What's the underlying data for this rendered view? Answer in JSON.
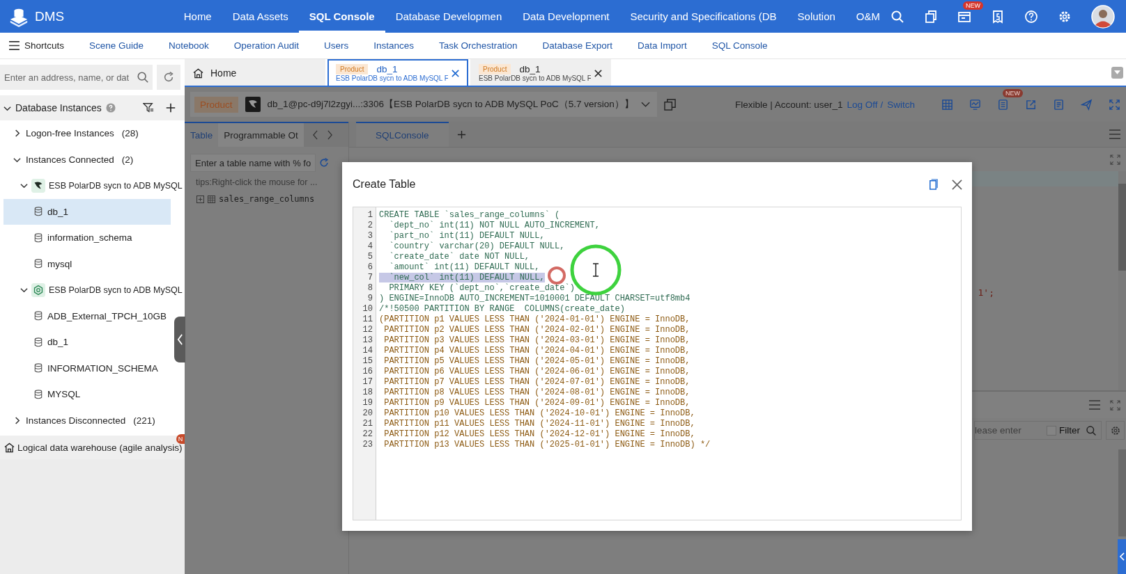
{
  "header": {
    "logo": "DMS",
    "nav": [
      {
        "label": "Home",
        "selected": false
      },
      {
        "label": "Data Assets",
        "selected": false
      },
      {
        "label": "SQL Console",
        "selected": true
      },
      {
        "label": "Database Developmen",
        "selected": false
      },
      {
        "label": "Data Development",
        "selected": false
      },
      {
        "label": "Security and Specifications (DB",
        "selected": false
      },
      {
        "label": "Solution",
        "selected": false
      },
      {
        "label": "O&M",
        "selected": false
      }
    ],
    "icons": [
      {
        "kind": "search"
      },
      {
        "kind": "copy"
      },
      {
        "kind": "ticket",
        "badge": "NEW"
      },
      {
        "kind": "receipt"
      },
      {
        "kind": "help"
      },
      {
        "kind": "settings"
      },
      {
        "kind": "avatar"
      }
    ]
  },
  "shortcuts": {
    "label": "Shortcuts",
    "links": [
      "Scene Guide",
      "Notebook",
      "Operation Audit",
      "Users",
      "Instances",
      "Task Orchestration",
      "Database Export",
      "Data Import",
      "SQL Console"
    ]
  },
  "sidebar": {
    "search": {
      "placeholder": "Enter an address, name, or dat"
    },
    "section": {
      "title": "Database Instances",
      "expanded": true
    },
    "tree": [
      {
        "kind": "group",
        "label": "Logon-free Instances",
        "count": "(28)",
        "expanded": false
      },
      {
        "kind": "group",
        "label": "Instances Connected",
        "count": "(2)",
        "expanded": true,
        "children": [
          {
            "kind": "polardb",
            "label": "ESB PolarDB sycn to ADB MySQL",
            "expanded": true,
            "children": [
              {
                "kind": "database",
                "label": "db_1",
                "selected": true
              },
              {
                "kind": "database",
                "label": "information_schema",
                "selected": false
              },
              {
                "kind": "database",
                "label": "mysql",
                "selected": false
              }
            ]
          },
          {
            "kind": "adb",
            "label": "ESB PolarDB sycn to ADB MySQL",
            "expanded": true,
            "children": [
              {
                "kind": "database",
                "label": "ADB_External_TPCH_10GB",
                "selected": false
              },
              {
                "kind": "database",
                "label": "db_1",
                "selected": false
              },
              {
                "kind": "database",
                "label": "INFORMATION_SCHEMA",
                "selected": false
              },
              {
                "kind": "database",
                "label": "MYSQL",
                "selected": false
              }
            ]
          }
        ]
      },
      {
        "kind": "group",
        "label": "Instances Disconnected",
        "count": "(221)",
        "expanded": false
      }
    ],
    "footer": {
      "label": "Logical data warehouse (agile analysis)",
      "badge": "N"
    }
  },
  "tabs": [
    {
      "kind": "home",
      "label": "Home",
      "selected": false
    },
    {
      "kind": "db",
      "tag": "Product",
      "label": "db_1",
      "subtitle": "ESB PolarDB sycn to ADB MySQL F",
      "selected": true
    },
    {
      "kind": "db",
      "tag": "Product",
      "label": "db_1",
      "subtitle": "ESB PolarDB sycn to ADB MySQL F",
      "selected": false
    }
  ],
  "connection": {
    "tag": "Product",
    "label": "db_1@pc-d9j7l2zgyi...:3306【ESB PolarDB sycn to ADB MySQL PoC（5.7 version）】",
    "account": "Flexible | Account: user_1",
    "log_off": "Log Off",
    "separator": "/",
    "switch": "Switch",
    "toolbar": [
      {
        "kind": "grid"
      },
      {
        "kind": "monitor"
      },
      {
        "kind": "list",
        "badge": "NEW"
      },
      {
        "kind": "export"
      },
      {
        "kind": "doc"
      },
      {
        "kind": "send"
      },
      {
        "kind": "fullscreen"
      }
    ]
  },
  "object_panel": {
    "tabs": [
      {
        "label": "Table",
        "selected": true
      },
      {
        "label": "Programmable Ot",
        "selected": false
      }
    ],
    "search": {
      "placeholder": "Enter a table name with % fo"
    },
    "tip": "tips:Right-click the mouse for ...",
    "tables": [
      {
        "name": "sales_range_columns",
        "expanded": false
      }
    ]
  },
  "console": {
    "tabs": [
      {
        "label": "SQLConsole",
        "selected": true
      }
    ],
    "code_fragment": "1';",
    "results": {
      "search": {
        "placeholder": "lease enter"
      },
      "filter": {
        "label": "Filter",
        "checked": false
      }
    }
  },
  "dialog": {
    "title": "Create Table",
    "lines": [
      {
        "n": "1",
        "kind": "ddl",
        "selected": false,
        "text": "CREATE TABLE `sales_range_columns` ("
      },
      {
        "n": "2",
        "kind": "ddl",
        "selected": false,
        "text": "  `dept_no` int(11) NOT NULL AUTO_INCREMENT,"
      },
      {
        "n": "3",
        "kind": "ddl",
        "selected": false,
        "text": "  `part_no` int(11) DEFAULT NULL,"
      },
      {
        "n": "4",
        "kind": "ddl",
        "selected": false,
        "text": "  `country` varchar(20) DEFAULT NULL,"
      },
      {
        "n": "5",
        "kind": "ddl",
        "selected": false,
        "text": "  `create_date` date NOT NULL,"
      },
      {
        "n": "6",
        "kind": "ddl",
        "selected": false,
        "text": "  `amount` int(11) DEFAULT NULL,"
      },
      {
        "n": "7",
        "kind": "ddl",
        "selected": true,
        "text": "  `new_col` int(11) DEFAULT NULL,"
      },
      {
        "n": "8",
        "kind": "ddl",
        "selected": false,
        "text": "  PRIMARY KEY (`dept_no`,`create_date`)"
      },
      {
        "n": "9",
        "kind": "ddl",
        "selected": false,
        "text": ") ENGINE=InnoDB AUTO_INCREMENT=1010001 DEFAULT CHARSET=utf8mb4"
      },
      {
        "n": "10",
        "kind": "ddl",
        "selected": false,
        "text": "/*!50500 PARTITION BY RANGE  COLUMNS(create_date)"
      },
      {
        "n": "11",
        "kind": "partition",
        "selected": false,
        "text": "(PARTITION p1 VALUES LESS THAN ('2024-01-01') ENGINE = InnoDB,"
      },
      {
        "n": "12",
        "kind": "partition",
        "selected": false,
        "text": " PARTITION p2 VALUES LESS THAN ('2024-02-01') ENGINE = InnoDB,"
      },
      {
        "n": "13",
        "kind": "partition",
        "selected": false,
        "text": " PARTITION p3 VALUES LESS THAN ('2024-03-01') ENGINE = InnoDB,"
      },
      {
        "n": "14",
        "kind": "partition",
        "selected": false,
        "text": " PARTITION p4 VALUES LESS THAN ('2024-04-01') ENGINE = InnoDB,"
      },
      {
        "n": "15",
        "kind": "partition",
        "selected": false,
        "text": " PARTITION p5 VALUES LESS THAN ('2024-05-01') ENGINE = InnoDB,"
      },
      {
        "n": "16",
        "kind": "partition",
        "selected": false,
        "text": " PARTITION p6 VALUES LESS THAN ('2024-06-01') ENGINE = InnoDB,"
      },
      {
        "n": "17",
        "kind": "partition",
        "selected": false,
        "text": " PARTITION p7 VALUES LESS THAN ('2024-07-01') ENGINE = InnoDB,"
      },
      {
        "n": "18",
        "kind": "partition",
        "selected": false,
        "text": " PARTITION p8 VALUES LESS THAN ('2024-08-01') ENGINE = InnoDB,"
      },
      {
        "n": "19",
        "kind": "partition",
        "selected": false,
        "text": " PARTITION p9 VALUES LESS THAN ('2024-09-01') ENGINE = InnoDB,"
      },
      {
        "n": "20",
        "kind": "partition",
        "selected": false,
        "text": " PARTITION p10 VALUES LESS THAN ('2024-10-01') ENGINE = InnoDB,"
      },
      {
        "n": "21",
        "kind": "partition",
        "selected": false,
        "text": " PARTITION p11 VALUES LESS THAN ('2024-11-01') ENGINE = InnoDB,"
      },
      {
        "n": "22",
        "kind": "partition",
        "selected": false,
        "text": " PARTITION p12 VALUES LESS THAN ('2024-12-01') ENGINE = InnoDB,"
      },
      {
        "n": "23",
        "kind": "partition",
        "selected": false,
        "text": " PARTITION p13 VALUES LESS THAN ('2025-01-01') ENGINE = InnoDB) */"
      }
    ]
  }
}
